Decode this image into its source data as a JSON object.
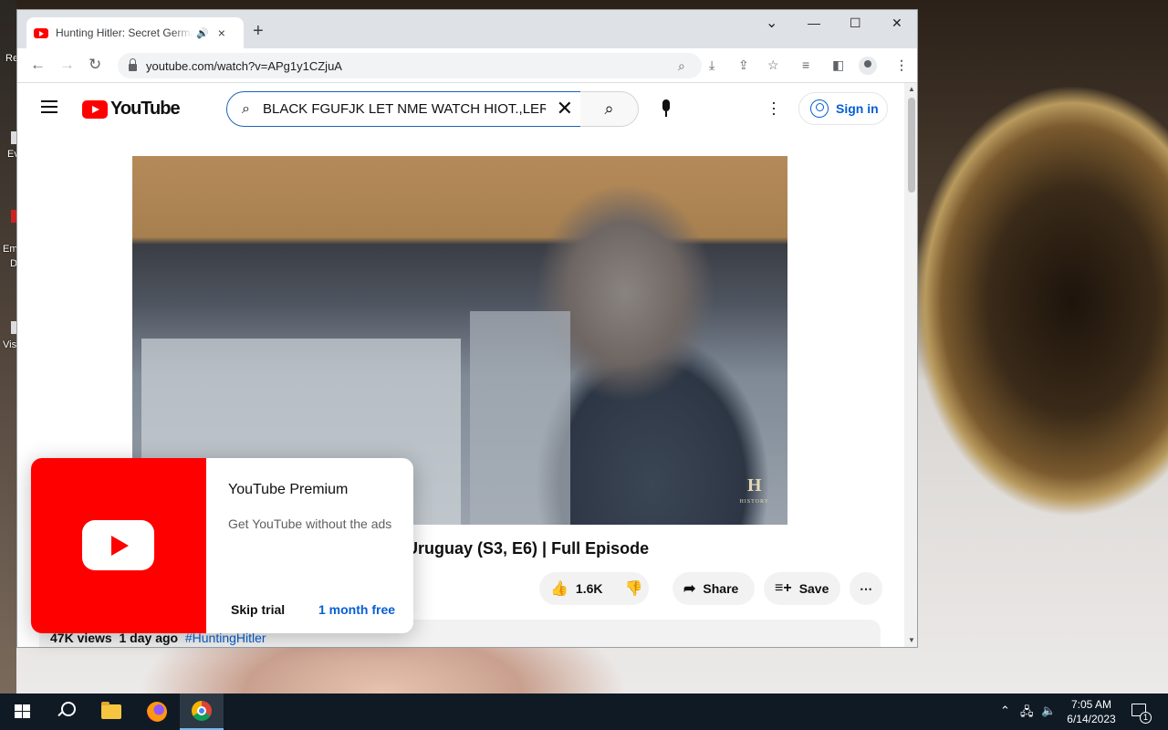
{
  "desktop": {
    "icon_labels": [
      "Re",
      "Ev",
      "Em",
      "D",
      "Vis"
    ]
  },
  "browser": {
    "tab": {
      "title": "Hunting Hitler: Secret German",
      "audio_icon": "speaker-icon",
      "close": "×"
    },
    "new_tab": "+",
    "window_controls": {
      "minimize": "—",
      "maximize": "☐",
      "close": "✕",
      "tab_search": "⌄"
    },
    "url": "youtube.com/watch?v=APg1y1CZjuA"
  },
  "youtube": {
    "logo_text": "YouTube",
    "search": {
      "query": "BLACK FGUFJK LET NME WATCH HIOT.,LER",
      "clear": "✕"
    },
    "sign_in": "Sign in",
    "video": {
      "title_visible": "Uruguay (S3, E6) | Full Episode",
      "watermark": "H",
      "watermark_sub": "HISTORY",
      "likes": "1.6K",
      "share": "Share",
      "save": "Save",
      "views": "47K views",
      "age": "1 day ago",
      "hashtag": "#HuntingHitler"
    },
    "premium_promo": {
      "title": "YouTube Premium",
      "subtitle": "Get YouTube without the ads",
      "skip": "Skip trial",
      "cta": "1 month free"
    }
  },
  "taskbar": {
    "time": "7:05 AM",
    "date": "6/14/2023",
    "notification_count": "1"
  },
  "colors": {
    "youtube_red": "#ff0000",
    "link_blue": "#065fd4",
    "taskbar": "#0f1a25"
  }
}
